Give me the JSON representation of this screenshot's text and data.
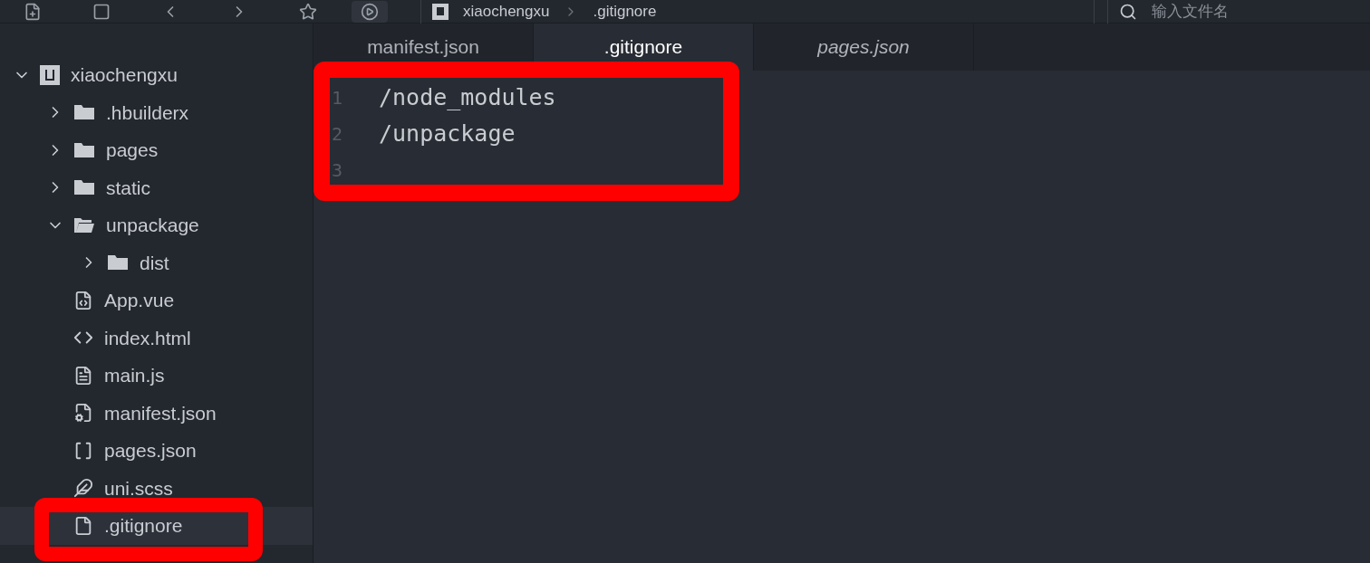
{
  "breadcrumb": [
    "xiaochengxu",
    ".gitignore"
  ],
  "search": {
    "placeholder": "输入文件名"
  },
  "tree": [
    {
      "label": "xiaochengxu",
      "kind": "project",
      "expanded": true,
      "selected": false,
      "children": [
        {
          "label": ".hbuilderx",
          "kind": "folder",
          "expanded": false,
          "selected": false
        },
        {
          "label": "pages",
          "kind": "folder",
          "expanded": false,
          "selected": false
        },
        {
          "label": "static",
          "kind": "folder",
          "expanded": false,
          "selected": false
        },
        {
          "label": "unpackage",
          "kind": "folder",
          "expanded": true,
          "selected": false,
          "children": [
            {
              "label": "dist",
              "kind": "folder",
              "expanded": false,
              "selected": false
            }
          ]
        },
        {
          "label": "App.vue",
          "kind": "vue",
          "selected": false
        },
        {
          "label": "index.html",
          "kind": "html",
          "selected": false
        },
        {
          "label": "main.js",
          "kind": "js",
          "selected": false
        },
        {
          "label": "manifest.json",
          "kind": "config",
          "selected": false
        },
        {
          "label": "pages.json",
          "kind": "json",
          "selected": false
        },
        {
          "label": "uni.scss",
          "kind": "scss",
          "selected": false
        },
        {
          "label": ".gitignore",
          "kind": "plain",
          "selected": true
        }
      ]
    }
  ],
  "tabs": [
    {
      "label": "manifest.json",
      "selected": false,
      "preview": false
    },
    {
      "label": ".gitignore",
      "selected": true,
      "preview": false
    },
    {
      "label": "pages.json",
      "selected": false,
      "preview": true
    }
  ],
  "editor": {
    "lines": [
      {
        "number": "1",
        "text": "/node_modules"
      },
      {
        "number": "2",
        "text": "/unpackage"
      },
      {
        "number": "3"
      }
    ]
  },
  "highlight_frames": {
    "code": true,
    "gitignore": true
  }
}
